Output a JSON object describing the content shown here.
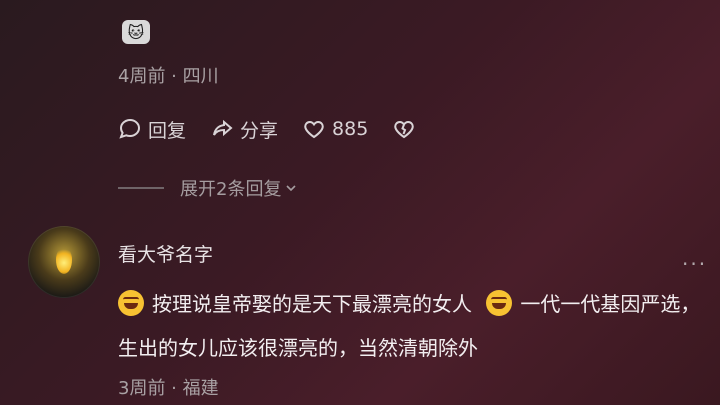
{
  "top_comment": {
    "truncated_text": "",
    "meta": "4周前 · 四川",
    "actions": {
      "reply_label": "回复",
      "share_label": "分享",
      "like_count": "885"
    },
    "expand_label": "展开2条回复"
  },
  "comment": {
    "username": "看大爷名字",
    "text_part1": "按理说皇帝娶的是天下最漂亮的女人",
    "text_part2": "一代一代基因严选，生出的女儿应该很漂亮的，当然清朝除外",
    "meta": "3周前 · 福建",
    "more_label": "···"
  },
  "icons": {
    "reply": "comment-bubble-icon",
    "share": "share-arrow-icon",
    "like": "heart-icon",
    "dislike": "broken-heart-icon",
    "emoji": "laughing-crying-emoji-icon",
    "cat_emoji": "cat-emoji-icon"
  },
  "colors": {
    "background": "#3b1a24",
    "text_primary": "#f2eef0",
    "text_secondary": "#a9a1a4"
  }
}
